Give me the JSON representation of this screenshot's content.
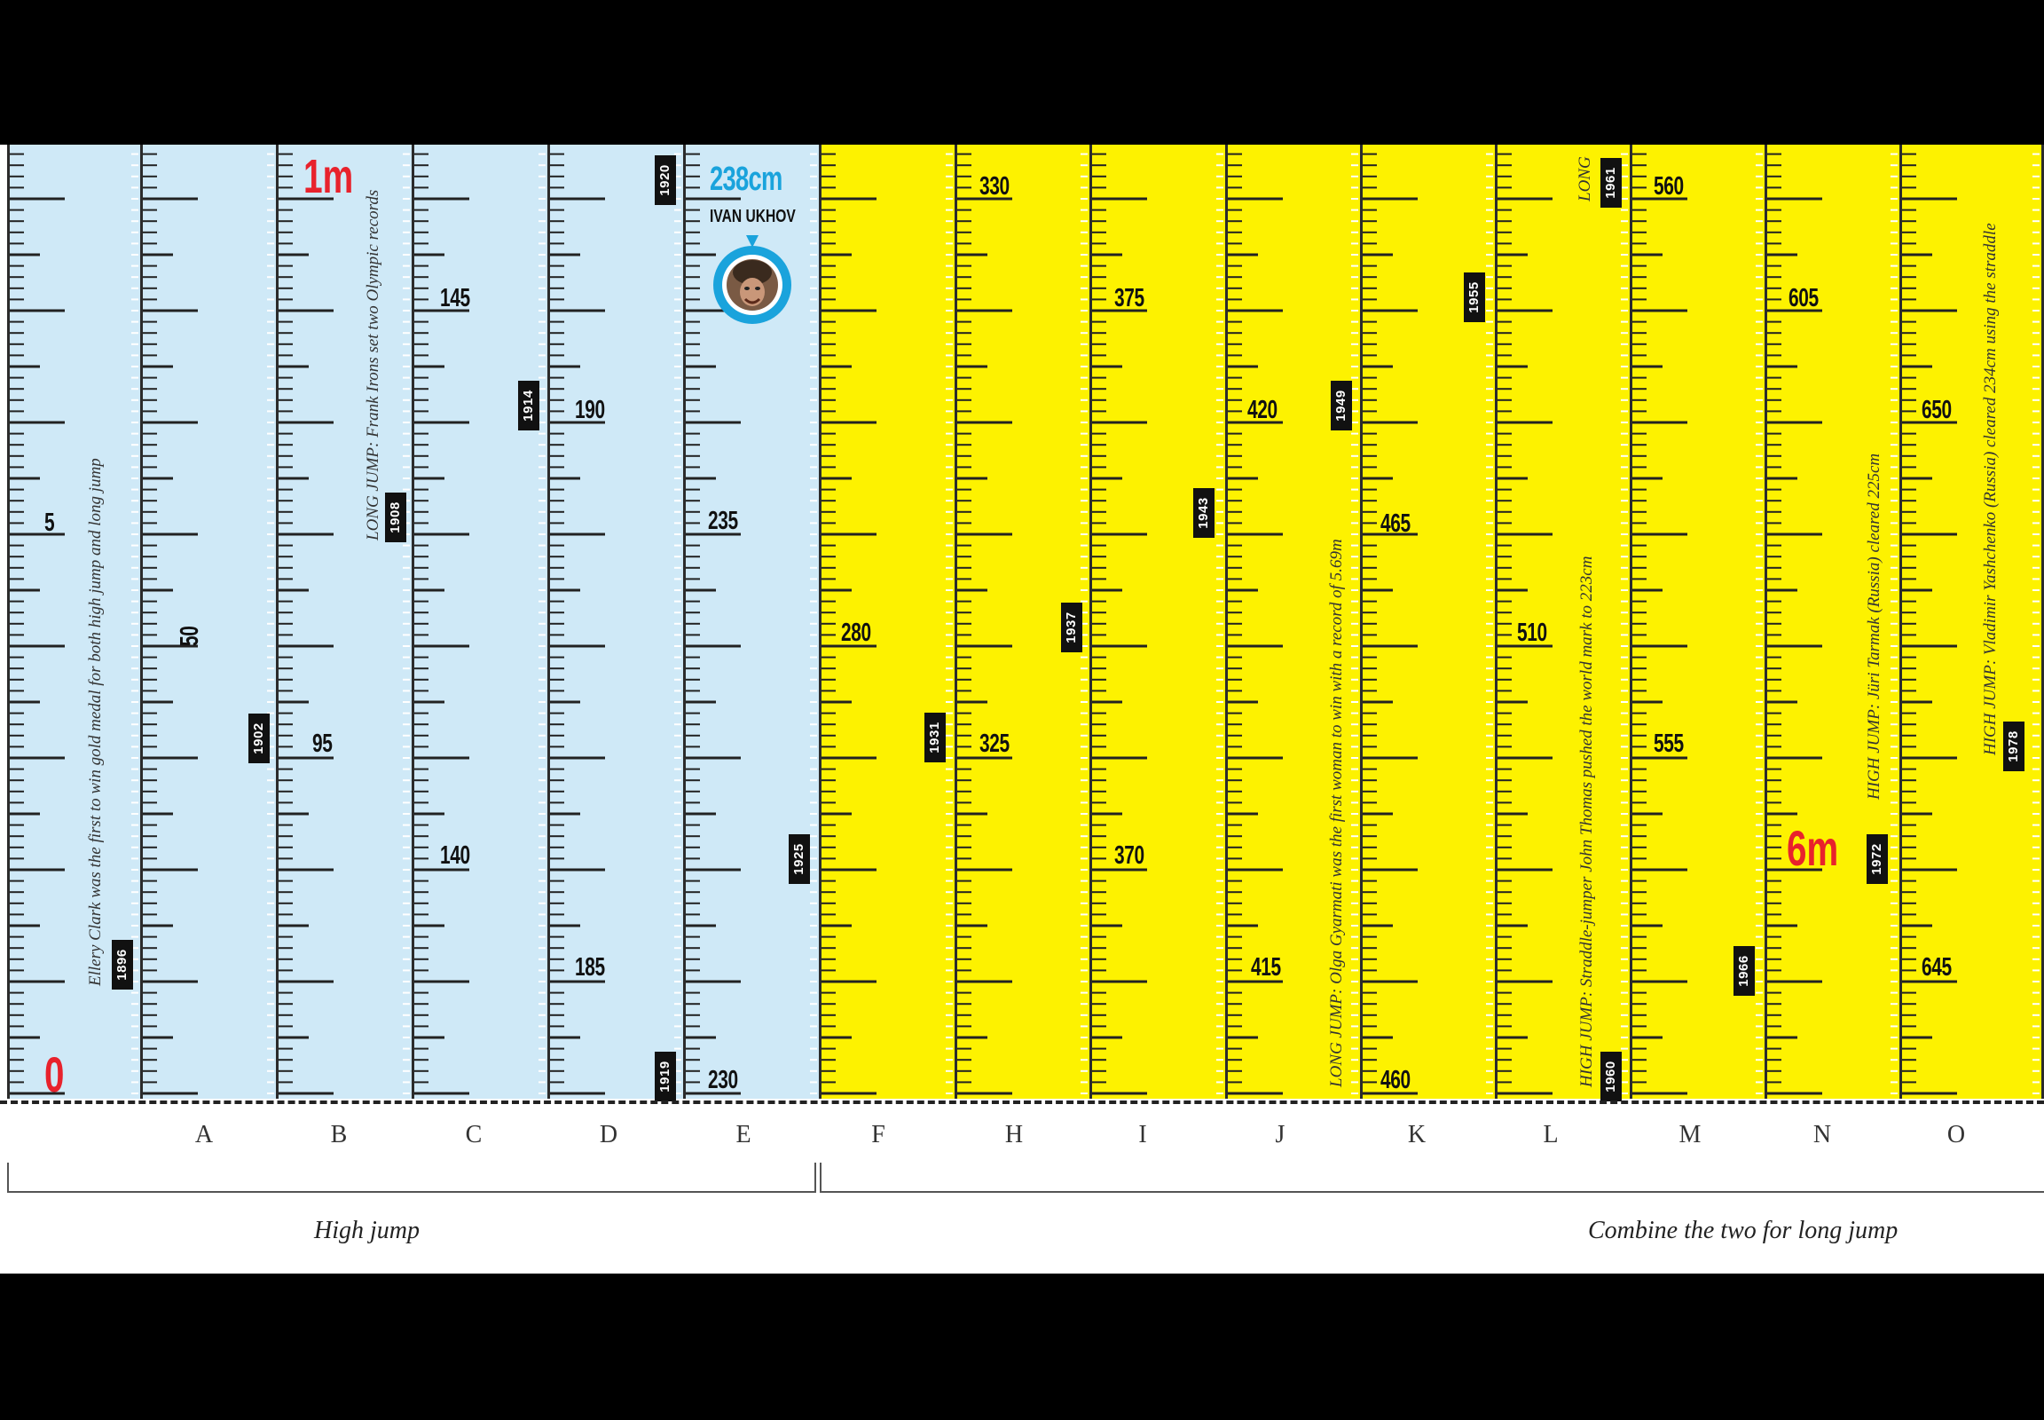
{
  "figure": {
    "strips": [
      {
        "letter": "",
        "color": "blue"
      },
      {
        "letter": "A",
        "color": "blue"
      },
      {
        "letter": "B",
        "color": "blue"
      },
      {
        "letter": "C",
        "color": "blue"
      },
      {
        "letter": "D",
        "color": "blue"
      },
      {
        "letter": "E",
        "color": "blue"
      },
      {
        "letter": "F",
        "color": "yellow"
      },
      {
        "letter": "H",
        "color": "yellow"
      },
      {
        "letter": "I",
        "color": "yellow"
      },
      {
        "letter": "J",
        "color": "yellow"
      },
      {
        "letter": "K",
        "color": "yellow"
      },
      {
        "letter": "L",
        "color": "yellow"
      },
      {
        "letter": "M",
        "color": "yellow"
      },
      {
        "letter": "N",
        "color": "yellow"
      },
      {
        "letter": "O",
        "color": "yellow"
      }
    ],
    "numbers": {
      "s0_5": "5",
      "sA_50": "50",
      "sB_95": "95",
      "sC_145": "145",
      "sC_140": "140",
      "sD_190": "190",
      "sD_185": "185",
      "sE_235": "235",
      "sE_230": "230",
      "sF_280": "280",
      "sH_330": "330",
      "sH_325": "325",
      "sI_375": "375",
      "sI_370": "370",
      "sJ_420": "420",
      "sJ_415": "415",
      "sK_465": "465",
      "sK_460": "460",
      "sL_510": "510",
      "sM_560": "560",
      "sM_555": "555",
      "sN_605": "605",
      "sO_650": "650",
      "sO_645": "645"
    },
    "big_marks": {
      "zero": "0",
      "one_m": "1m",
      "six_m": "6m"
    },
    "highlight": {
      "value": "238cm",
      "athlete": "IVAN UKHOV"
    },
    "years": {
      "y1896": "1896",
      "y1902": "1902",
      "y1908": "1908",
      "y1914": "1914",
      "y1919": "1919",
      "y1920": "1920",
      "y1925": "1925",
      "y1931": "1931",
      "y1937": "1937",
      "y1943": "1943",
      "y1949": "1949",
      "y1955": "1955",
      "y1960": "1960",
      "y1961": "1961",
      "y1966": "1966",
      "y1972": "1972",
      "y1978": "1978"
    },
    "annotations": {
      "clark": "Ellery Clark was the first to win gold medal for both high jump and long jump",
      "irons": "LONG JUMP: Frank Irons set two Olympic records",
      "gyarmati": "LONG JUMP: Olga Gyarmati was the first woman to win with a record of 5.69m",
      "thomas": "HIGH JUMP: Straddle-jumper John Thomas pushed the world mark to 223cm",
      "long_cut": "LONG",
      "tarmak": "HIGH JUMP: Jüri Tarmak (Russia) cleared 225cm",
      "yashchenko": "HIGH JUMP: Vladimir Yashchenko (Russia) cleared 234cm using the straddle"
    },
    "groups": {
      "high": "High jump",
      "long": "Combine the two for long jump"
    },
    "colors": {
      "blue_strip": "#cfe9f7",
      "yellow_strip": "#fdf200",
      "accent_red": "#e8222c",
      "accent_blue": "#1aa3dc"
    }
  }
}
